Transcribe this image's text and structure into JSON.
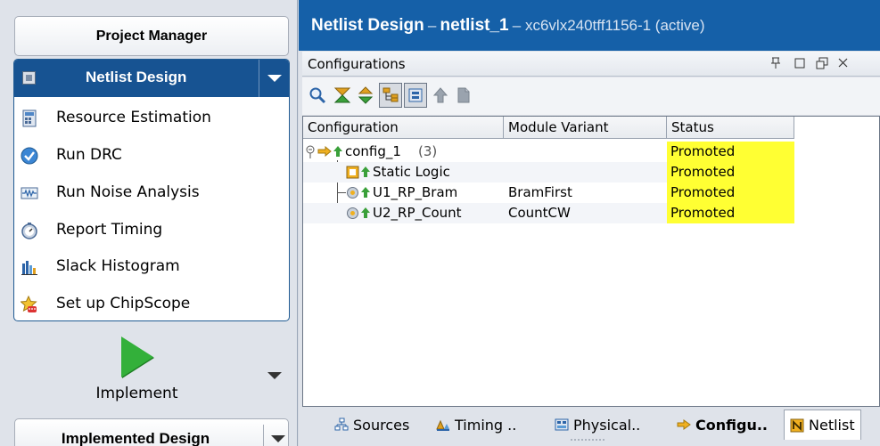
{
  "flow": {
    "project_manager": "Project Manager",
    "netlist_design": {
      "title": "Netlist Design",
      "items": [
        {
          "label": "Resource Estimation",
          "icon": "resource-estimation-icon"
        },
        {
          "label": "Run DRC",
          "icon": "run-drc-check-icon"
        },
        {
          "label": "Run Noise Analysis",
          "icon": "noise-waveform-icon"
        },
        {
          "label": "Report Timing",
          "icon": "stopwatch-icon"
        },
        {
          "label": "Slack Histogram",
          "icon": "histogram-icon"
        },
        {
          "label": "Set up ChipScope",
          "icon": "chipscope-icon"
        }
      ]
    },
    "implement": "Implement",
    "implemented_design": "Implemented Design"
  },
  "header": {
    "title": "Netlist Design",
    "separator": "–",
    "netlist": "netlist_1",
    "device": "– xc6vlx240tff1156-1 (active)"
  },
  "configurations": {
    "tab_title": "Configurations",
    "window_controls": [
      "pin",
      "restore",
      "maximize",
      "close"
    ],
    "columns": [
      "Configuration",
      "Module Variant",
      "Status"
    ],
    "rows": [
      {
        "config": "config_1",
        "count": "(3)",
        "variant": "",
        "status": "Promoted"
      },
      {
        "config": "Static Logic",
        "count": "",
        "variant": "",
        "status": "Promoted"
      },
      {
        "config": "U1_RP_Bram",
        "count": "",
        "variant": "BramFirst",
        "status": "Promoted"
      },
      {
        "config": "U2_RP_Count",
        "count": "",
        "variant": "CountCW",
        "status": "Promoted"
      }
    ]
  },
  "bottom_tabs": [
    {
      "label": "Sources",
      "icon": "sources-icon"
    },
    {
      "label": "Timing ..",
      "icon": "timing-icon"
    },
    {
      "label": "Physical..",
      "icon": "physical-icon"
    },
    {
      "label": "Configu..",
      "icon": "configurations-icon",
      "active": true
    },
    {
      "label": "Netlist",
      "icon": "netlist-icon"
    }
  ],
  "colors": {
    "flow_header": "#175392",
    "title_bar": "#1560a8",
    "status_highlight": "#ffff33",
    "implement_play": "#33b03a"
  }
}
